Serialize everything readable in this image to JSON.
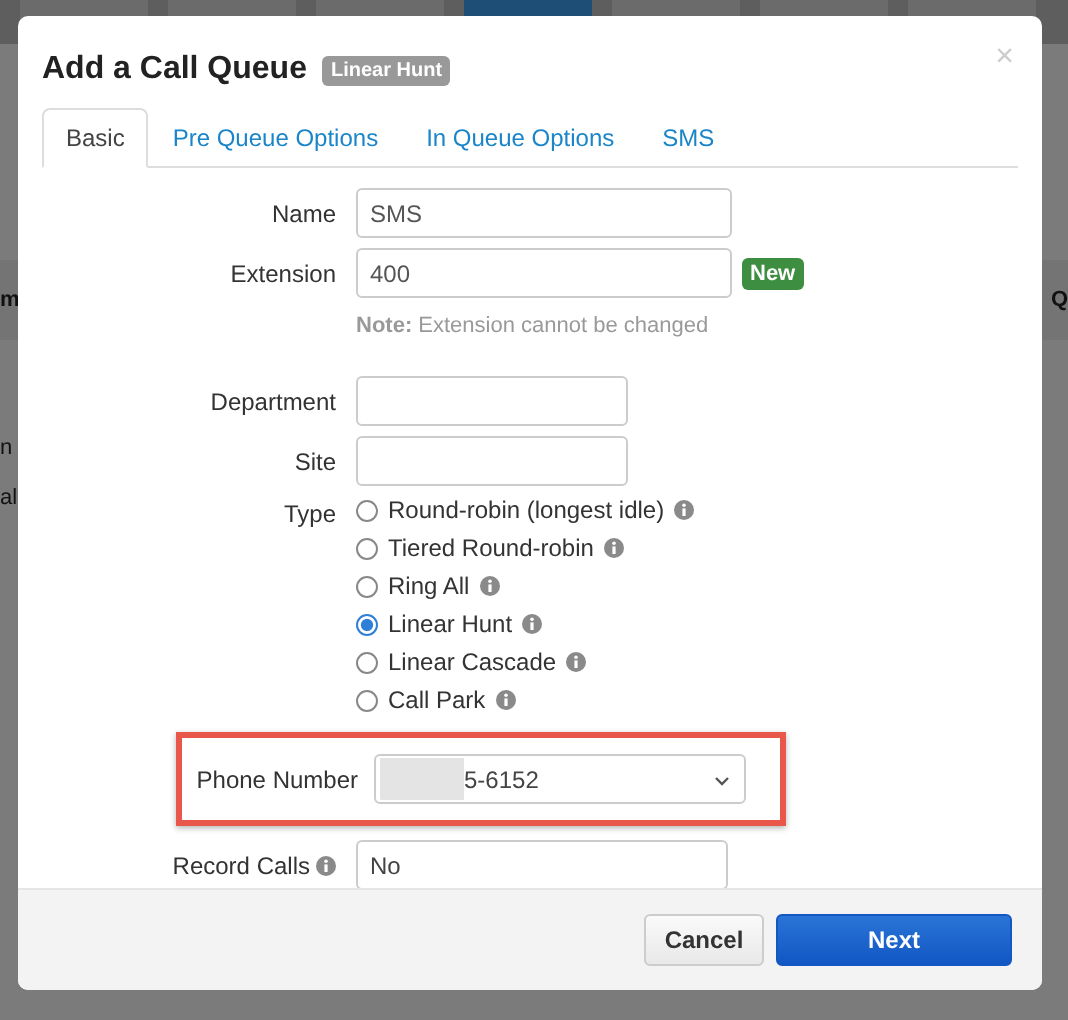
{
  "background": {
    "fragments": [
      "m",
      "Q",
      "n",
      "al"
    ]
  },
  "dialog": {
    "title": "Add a Call Queue",
    "badge": "Linear Hunt",
    "close": "×"
  },
  "tabs": [
    {
      "label": "Basic",
      "selected": true
    },
    {
      "label": "Pre Queue Options",
      "selected": false
    },
    {
      "label": "In Queue Options",
      "selected": false
    },
    {
      "label": "SMS",
      "selected": false
    }
  ],
  "form": {
    "name": {
      "label": "Name",
      "value": "SMS"
    },
    "extension": {
      "label": "Extension",
      "value": "400",
      "badge": "New"
    },
    "note": "**Note:** Extension cannot be changed",
    "department": {
      "label": "Department"
    },
    "site": {
      "label": "Site"
    },
    "type": {
      "label": "Type",
      "options": [
        {
          "label": "Round-robin (longest idle)",
          "selected": false
        },
        {
          "label": "Tiered Round-robin",
          "selected": false
        },
        {
          "label": "Ring All",
          "selected": false
        },
        {
          "label": "Linear Hunt",
          "selected": true
        },
        {
          "label": "Linear Cascade",
          "selected": false
        },
        {
          "label": "Call Park",
          "selected": false
        }
      ]
    },
    "phone_number": {
      "label": "Phone Number",
      "value": "5-6152"
    },
    "record_calls": {
      "label": "Record Calls",
      "value": "No"
    }
  },
  "buttons": [
    {
      "label": "Cancel",
      "kind": "secondary"
    },
    {
      "label": "Next",
      "kind": "primary"
    }
  ]
}
